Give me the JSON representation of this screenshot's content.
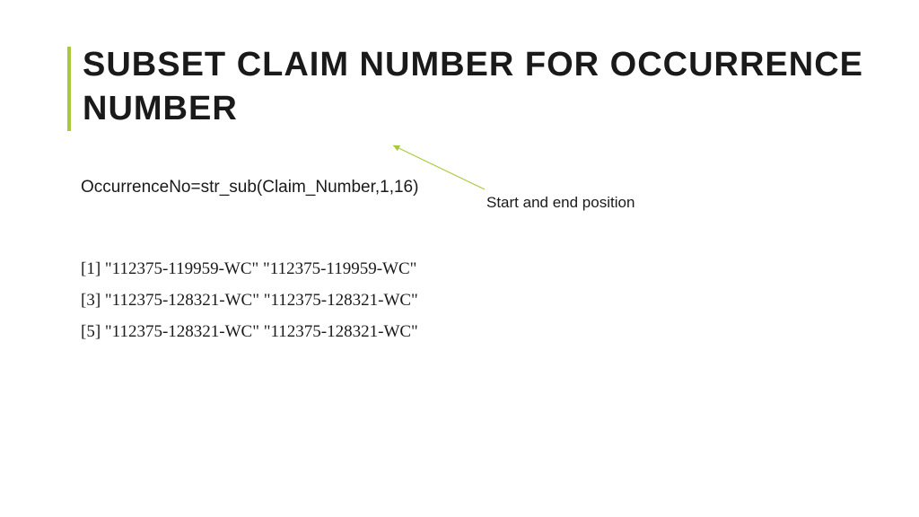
{
  "title_line1": "SUBSET CLAIM NUMBER FOR OCCURRENCE",
  "title_line2": "NUMBER",
  "code": "OccurrenceNo=str_sub(Claim_Number,1,16)",
  "annotation": "Start and end position",
  "output": [
    {
      "idx": "[1]",
      "v1": "\"112375-119959-WC\"",
      "v2": "\"112375-119959-WC\""
    },
    {
      "idx": "[3]",
      "v1": "\"112375-128321-WC\"",
      "v2": "\"112375-128321-WC\""
    },
    {
      "idx": "[5]",
      "v1": "\"112375-128321-WC\"",
      "v2": "\"112375-128321-WC\""
    }
  ],
  "accent_color": "#a8c93e"
}
